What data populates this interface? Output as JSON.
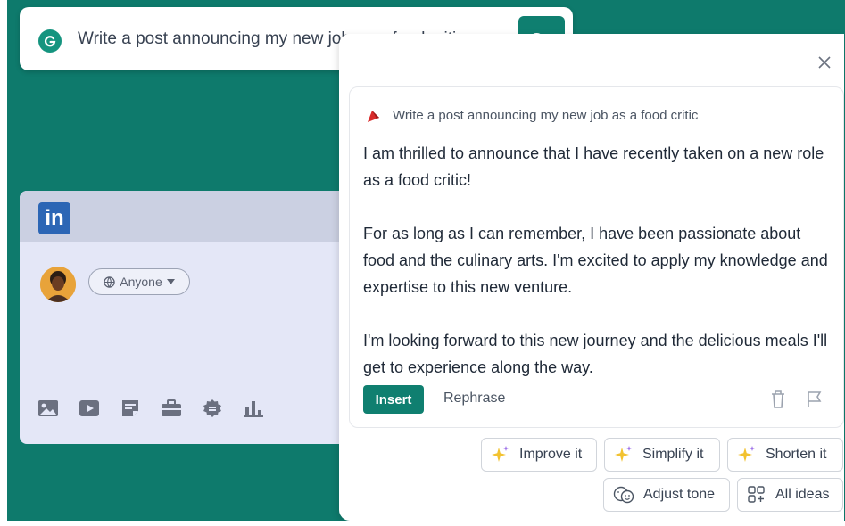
{
  "prompt_bar": {
    "text": "Write a post announcing my new job as a food critic",
    "go_label": "Go"
  },
  "linkedin": {
    "logo_text": "in",
    "visibility_label": "Anyone"
  },
  "suggestion": {
    "prompt_echo": "Write a post announcing my new job as a food critic",
    "paragraphs": [
      "I am thrilled to announce that I have recently taken on a new role as a food critic!",
      "For as long as I can remember, I have been passionate about food and the culinary arts. I'm excited to apply my knowledge and expertise to this new venture.",
      "I'm looking forward to this new journey and the delicious meals I'll get to experience along the way."
    ],
    "insert_label": "Insert",
    "rephrase_label": "Rephrase"
  },
  "chips": {
    "improve": "Improve it",
    "simplify": "Simplify it",
    "shorten": "Shorten it",
    "adjust_tone": "Adjust tone",
    "all_ideas": "All ideas"
  },
  "colors": {
    "background": "#0e7a6c",
    "brand_green": "#0f7f70",
    "linkedin_blue": "#2c66b5"
  }
}
